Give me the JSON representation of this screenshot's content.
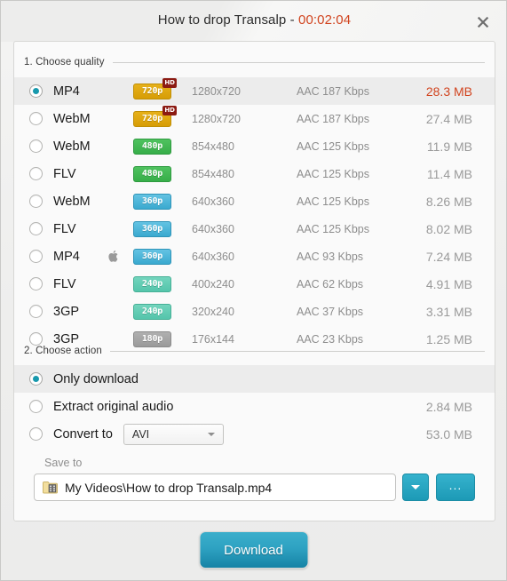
{
  "window": {
    "title_main": "How to drop Transalp - ",
    "title_time": "00:02:04",
    "close_icon": "close-icon"
  },
  "sections": {
    "quality": {
      "label": "1. Choose quality"
    },
    "action": {
      "label": "2. Choose action"
    }
  },
  "quality_rows": [
    {
      "format": "MP4",
      "badge": "720p",
      "badge_class": "c720",
      "hd": "HD",
      "apple": false,
      "resolution": "1280x720",
      "audio": "AAC 187  Kbps",
      "size": "28.3 MB",
      "selected": true
    },
    {
      "format": "WebM",
      "badge": "720p",
      "badge_class": "c720",
      "hd": "HD",
      "apple": false,
      "resolution": "1280x720",
      "audio": "AAC 187  Kbps",
      "size": "27.4 MB",
      "selected": false
    },
    {
      "format": "WebM",
      "badge": "480p",
      "badge_class": "c480",
      "hd": "",
      "apple": false,
      "resolution": "854x480",
      "audio": "AAC 125  Kbps",
      "size": "11.9 MB",
      "selected": false
    },
    {
      "format": "FLV",
      "badge": "480p",
      "badge_class": "c480",
      "hd": "",
      "apple": false,
      "resolution": "854x480",
      "audio": "AAC 125  Kbps",
      "size": "11.4 MB",
      "selected": false
    },
    {
      "format": "WebM",
      "badge": "360p",
      "badge_class": "c360",
      "hd": "",
      "apple": false,
      "resolution": "640x360",
      "audio": "AAC 125  Kbps",
      "size": "8.26 MB",
      "selected": false
    },
    {
      "format": "FLV",
      "badge": "360p",
      "badge_class": "c360",
      "hd": "",
      "apple": false,
      "resolution": "640x360",
      "audio": "AAC 125  Kbps",
      "size": "8.02 MB",
      "selected": false
    },
    {
      "format": "MP4",
      "badge": "360p",
      "badge_class": "c360",
      "hd": "",
      "apple": true,
      "resolution": "640x360",
      "audio": "AAC 93  Kbps",
      "size": "7.24 MB",
      "selected": false
    },
    {
      "format": "FLV",
      "badge": "240p",
      "badge_class": "c240",
      "hd": "",
      "apple": false,
      "resolution": "400x240",
      "audio": "AAC 62  Kbps",
      "size": "4.91 MB",
      "selected": false
    },
    {
      "format": "3GP",
      "badge": "240p",
      "badge_class": "c240",
      "hd": "",
      "apple": false,
      "resolution": "320x240",
      "audio": "AAC 37  Kbps",
      "size": "3.31 MB",
      "selected": false
    },
    {
      "format": "3GP",
      "badge": "180p",
      "badge_class": "c180",
      "hd": "",
      "apple": false,
      "resolution": "176x144",
      "audio": "AAC 23  Kbps",
      "size": "1.25 MB",
      "selected": false
    }
  ],
  "action_rows": [
    {
      "label": "Only download",
      "size": "",
      "selected": true,
      "has_select": false
    },
    {
      "label": "Extract original audio",
      "size": "2.84 MB",
      "selected": false,
      "has_select": false
    },
    {
      "label": "Convert to",
      "size": "53.0 MB",
      "selected": false,
      "has_select": true
    }
  ],
  "convert_select": {
    "value": "AVI"
  },
  "save_to": {
    "label": "Save to",
    "path": "My Videos\\How to drop Transalp.mp4",
    "folder_icon": "video-folder-icon",
    "dropdown_icon": "chevron-down-icon",
    "browse_label": "..."
  },
  "download_button": {
    "label": "Download"
  },
  "colors": {
    "accent_teal": "#1899ad",
    "highlight_red": "#d1441f",
    "badge_720": "#d79d06",
    "badge_480": "#37ae49",
    "badge_360": "#3aa9cf",
    "badge_240": "#54c5ab",
    "badge_180": "#9a9a9a"
  }
}
